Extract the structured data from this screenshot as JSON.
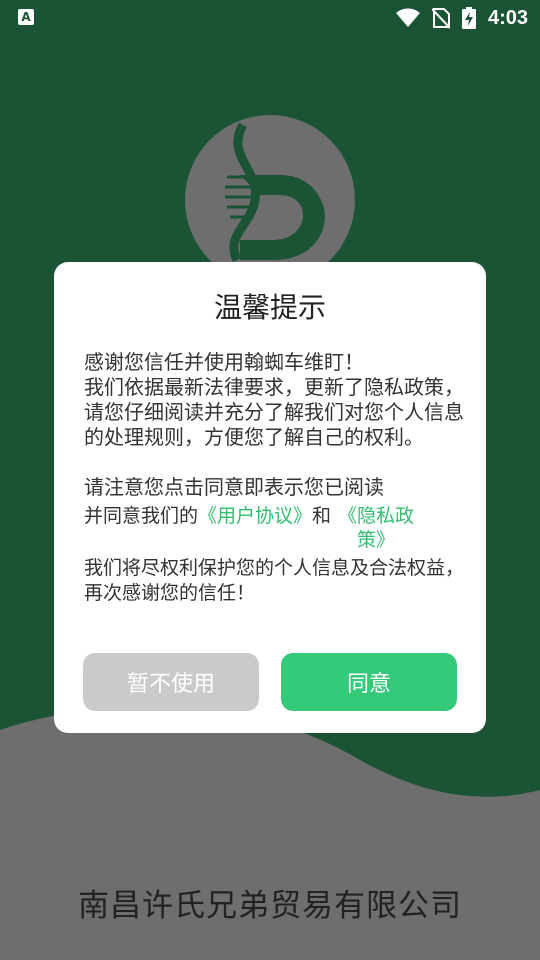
{
  "status_bar": {
    "app_icon_letter": "A",
    "time": "4:03"
  },
  "splash": {
    "company_name": "南昌许氏兄弟贸易有限公司"
  },
  "dialog": {
    "title": "温馨提示",
    "line1": "感谢您信任并使用翰蜘车维盯！",
    "line2": "我们依据最新法律要求，更新了隐私政策，请您仔细阅读并充分了解我们对您个人信息的处理规则，方便您了解自己的权利。",
    "notice_line1": "请注意您点击同意即表示您已阅读",
    "notice_prefix": "并同意我们的",
    "user_agreement_link": "《用户协议》",
    "and_text": "和",
    "privacy_policy_link": "《隐私政策》",
    "closing": "我们将尽权利保护您的个人信息及合法权益，再次感谢您的信任！",
    "decline_label": "暂不使用",
    "agree_label": "同意"
  },
  "colors": {
    "background": "#1b5335",
    "wave": "#6e6e6e",
    "accent": "#35c97a",
    "link": "#2fbf6e",
    "decline_button": "#cacaca"
  }
}
